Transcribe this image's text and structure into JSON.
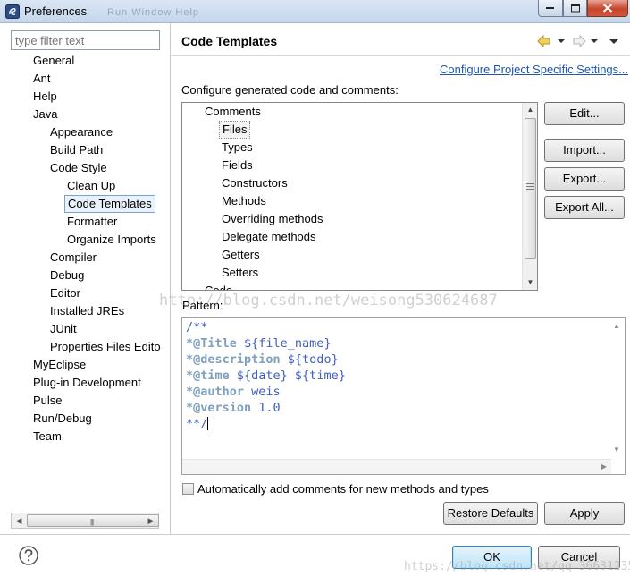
{
  "window": {
    "title": "Preferences",
    "faded_menu": "Run   Window   Help"
  },
  "filter": {
    "placeholder": "type filter text",
    "value": ""
  },
  "nav_tree": [
    {
      "label": "General",
      "level": 0
    },
    {
      "label": "Ant",
      "level": 0
    },
    {
      "label": "Help",
      "level": 0
    },
    {
      "label": "Java",
      "level": 0
    },
    {
      "label": "Appearance",
      "level": 1
    },
    {
      "label": "Build Path",
      "level": 1
    },
    {
      "label": "Code Style",
      "level": 1
    },
    {
      "label": "Clean Up",
      "level": 2
    },
    {
      "label": "Code Templates",
      "level": 2,
      "selected": true
    },
    {
      "label": "Formatter",
      "level": 2
    },
    {
      "label": "Organize Imports",
      "level": 2
    },
    {
      "label": "Compiler",
      "level": 1
    },
    {
      "label": "Debug",
      "level": 1
    },
    {
      "label": "Editor",
      "level": 1
    },
    {
      "label": "Installed JREs",
      "level": 1
    },
    {
      "label": "JUnit",
      "level": 1
    },
    {
      "label": "Properties Files Edito",
      "level": 1
    },
    {
      "label": "MyEclipse",
      "level": 0
    },
    {
      "label": "Plug-in Development",
      "level": 0
    },
    {
      "label": "Pulse",
      "level": 0
    },
    {
      "label": "Run/Debug",
      "level": 0
    },
    {
      "label": "Team",
      "level": 0
    }
  ],
  "page": {
    "title": "Code Templates",
    "link": "Configure Project Specific Settings...",
    "config_label": "Configure generated code and comments:"
  },
  "template_tree": [
    {
      "label": "Comments",
      "level": 0
    },
    {
      "label": "Files",
      "level": 1,
      "selected": true
    },
    {
      "label": "Types",
      "level": 1
    },
    {
      "label": "Fields",
      "level": 1
    },
    {
      "label": "Constructors",
      "level": 1
    },
    {
      "label": "Methods",
      "level": 1
    },
    {
      "label": "Overriding methods",
      "level": 1
    },
    {
      "label": "Delegate methods",
      "level": 1
    },
    {
      "label": "Getters",
      "level": 1
    },
    {
      "label": "Setters",
      "level": 1
    },
    {
      "label": "Code",
      "level": 0
    }
  ],
  "side_buttons": {
    "edit": "Edit...",
    "import": "Import...",
    "export": "Export...",
    "export_all": "Export All..."
  },
  "pattern": {
    "label": "Pattern:",
    "lines": [
      {
        "tag": "",
        "text": "/**"
      },
      {
        "tag": "*@Title",
        "text": " ${file_name}"
      },
      {
        "tag": "*@description",
        "text": " ${todo}"
      },
      {
        "tag": "*@time",
        "text": " ${date} ${time}"
      },
      {
        "tag": "*@author",
        "text": " weis"
      },
      {
        "tag": "*@version",
        "text": " 1.0"
      },
      {
        "tag": "",
        "text": "**/"
      }
    ]
  },
  "auto_comments": {
    "label": "Automatically add comments for new methods and types",
    "checked": false
  },
  "page_buttons": {
    "restore_defaults": "Restore Defaults",
    "apply": "Apply"
  },
  "dialog_buttons": {
    "ok": "OK",
    "cancel": "Cancel"
  },
  "watermarks": {
    "center": "http://blog.csdn.net/weisong530624687",
    "corner": "https://blog.csdn.net/qq_36631235"
  },
  "colors": {
    "javadoc_text": "#3f5fbf",
    "javadoc_tag": "#7f9fbf",
    "link": "#1c56b3",
    "selection_border": "#7da2ce"
  }
}
